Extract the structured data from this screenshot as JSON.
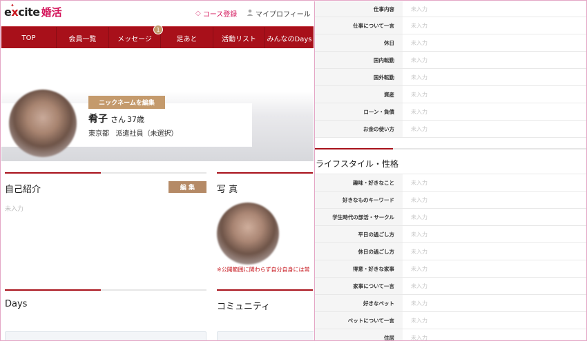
{
  "header": {
    "logo_left": "e",
    "logo_x": "x",
    "logo_rest": "cite",
    "logo_konkatsu": "婚活",
    "course_link": "コース登録",
    "profile_link": "マイプロフィール"
  },
  "nav": {
    "items": [
      "TOP",
      "会員一覧",
      "メッセージ",
      "足あと",
      "活動リスト",
      "みんなのDays"
    ],
    "message_badge": "1"
  },
  "profile": {
    "nickname_button": "ニックネームを編集",
    "name": "肴子",
    "honorific": "さん",
    "age": "37歳",
    "location": "東京都",
    "job": "派遣社員（未選択）"
  },
  "sections": {
    "self_intro": {
      "title": "自己紹介",
      "edit": "編 集",
      "body": "未入力"
    },
    "photo": {
      "title": "写 真",
      "note": "※公開範囲に関わらず自分自身には常"
    },
    "days": {
      "title": "Days"
    },
    "community": {
      "title": "コミュニティ"
    }
  },
  "details": {
    "group1": [
      {
        "label": "仕事内容",
        "value": "未入力"
      },
      {
        "label": "仕事について一言",
        "value": "未入力"
      },
      {
        "label": "休日",
        "value": "未入力"
      },
      {
        "label": "国内転勤",
        "value": "未入力"
      },
      {
        "label": "国外転勤",
        "value": "未入力"
      },
      {
        "label": "資産",
        "value": "未入力"
      },
      {
        "label": "ローン・負債",
        "value": "未入力"
      },
      {
        "label": "お金の使い方",
        "value": "未入力"
      }
    ],
    "lifestyle_title": "ライフスタイル・性格",
    "group2": [
      {
        "label": "趣味・好きなこと",
        "value": "未入力"
      },
      {
        "label": "好きなものキーワード",
        "value": "未入力"
      },
      {
        "label": "学生時代の部活・サークル",
        "value": "未入力"
      },
      {
        "label": "平日の過ごし方",
        "value": "未入力"
      },
      {
        "label": "休日の過ごし方",
        "value": "未入力"
      },
      {
        "label": "得意・好きな家事",
        "value": "未入力"
      },
      {
        "label": "家事について一言",
        "value": "未入力"
      },
      {
        "label": "好きなペット",
        "value": "未入力"
      },
      {
        "label": "ペットについて一言",
        "value": "未入力"
      },
      {
        "label": "住居",
        "value": "未入力"
      }
    ]
  },
  "colors": {
    "nav_red": "#a8101a",
    "brand_pink": "#d4145a",
    "button_tan": "#c49a6c",
    "frame_pink": "#e4a6c6"
  },
  "icons": {
    "course": "diamond-icon",
    "profile": "person-icon"
  }
}
